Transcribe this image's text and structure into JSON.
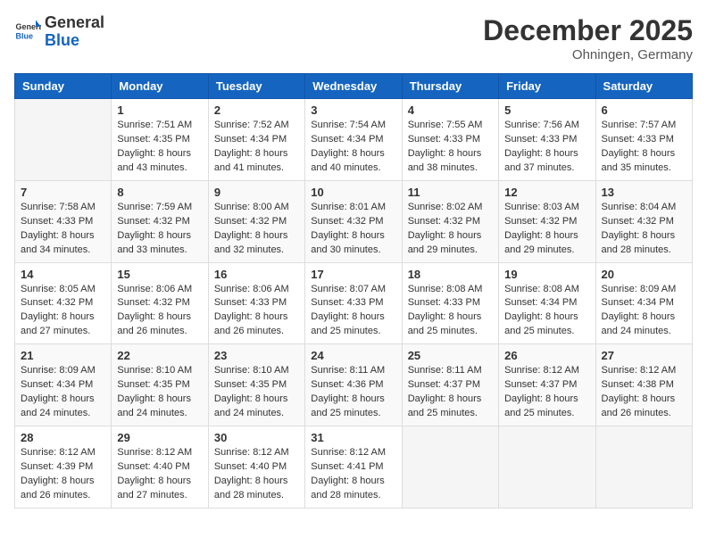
{
  "header": {
    "logo_general": "General",
    "logo_blue": "Blue",
    "month_title": "December 2025",
    "location": "Ohningen, Germany"
  },
  "days_of_week": [
    "Sunday",
    "Monday",
    "Tuesday",
    "Wednesday",
    "Thursday",
    "Friday",
    "Saturday"
  ],
  "weeks": [
    [
      {
        "day": "",
        "sunrise": "",
        "sunset": "",
        "daylight": ""
      },
      {
        "day": "1",
        "sunrise": "7:51 AM",
        "sunset": "4:35 PM",
        "daylight": "8 hours and 43 minutes."
      },
      {
        "day": "2",
        "sunrise": "7:52 AM",
        "sunset": "4:34 PM",
        "daylight": "8 hours and 41 minutes."
      },
      {
        "day": "3",
        "sunrise": "7:54 AM",
        "sunset": "4:34 PM",
        "daylight": "8 hours and 40 minutes."
      },
      {
        "day": "4",
        "sunrise": "7:55 AM",
        "sunset": "4:33 PM",
        "daylight": "8 hours and 38 minutes."
      },
      {
        "day": "5",
        "sunrise": "7:56 AM",
        "sunset": "4:33 PM",
        "daylight": "8 hours and 37 minutes."
      },
      {
        "day": "6",
        "sunrise": "7:57 AM",
        "sunset": "4:33 PM",
        "daylight": "8 hours and 35 minutes."
      }
    ],
    [
      {
        "day": "7",
        "sunrise": "7:58 AM",
        "sunset": "4:33 PM",
        "daylight": "8 hours and 34 minutes."
      },
      {
        "day": "8",
        "sunrise": "7:59 AM",
        "sunset": "4:32 PM",
        "daylight": "8 hours and 33 minutes."
      },
      {
        "day": "9",
        "sunrise": "8:00 AM",
        "sunset": "4:32 PM",
        "daylight": "8 hours and 32 minutes."
      },
      {
        "day": "10",
        "sunrise": "8:01 AM",
        "sunset": "4:32 PM",
        "daylight": "8 hours and 30 minutes."
      },
      {
        "day": "11",
        "sunrise": "8:02 AM",
        "sunset": "4:32 PM",
        "daylight": "8 hours and 29 minutes."
      },
      {
        "day": "12",
        "sunrise": "8:03 AM",
        "sunset": "4:32 PM",
        "daylight": "8 hours and 29 minutes."
      },
      {
        "day": "13",
        "sunrise": "8:04 AM",
        "sunset": "4:32 PM",
        "daylight": "8 hours and 28 minutes."
      }
    ],
    [
      {
        "day": "14",
        "sunrise": "8:05 AM",
        "sunset": "4:32 PM",
        "daylight": "8 hours and 27 minutes."
      },
      {
        "day": "15",
        "sunrise": "8:06 AM",
        "sunset": "4:32 PM",
        "daylight": "8 hours and 26 minutes."
      },
      {
        "day": "16",
        "sunrise": "8:06 AM",
        "sunset": "4:33 PM",
        "daylight": "8 hours and 26 minutes."
      },
      {
        "day": "17",
        "sunrise": "8:07 AM",
        "sunset": "4:33 PM",
        "daylight": "8 hours and 25 minutes."
      },
      {
        "day": "18",
        "sunrise": "8:08 AM",
        "sunset": "4:33 PM",
        "daylight": "8 hours and 25 minutes."
      },
      {
        "day": "19",
        "sunrise": "8:08 AM",
        "sunset": "4:34 PM",
        "daylight": "8 hours and 25 minutes."
      },
      {
        "day": "20",
        "sunrise": "8:09 AM",
        "sunset": "4:34 PM",
        "daylight": "8 hours and 24 minutes."
      }
    ],
    [
      {
        "day": "21",
        "sunrise": "8:09 AM",
        "sunset": "4:34 PM",
        "daylight": "8 hours and 24 minutes."
      },
      {
        "day": "22",
        "sunrise": "8:10 AM",
        "sunset": "4:35 PM",
        "daylight": "8 hours and 24 minutes."
      },
      {
        "day": "23",
        "sunrise": "8:10 AM",
        "sunset": "4:35 PM",
        "daylight": "8 hours and 24 minutes."
      },
      {
        "day": "24",
        "sunrise": "8:11 AM",
        "sunset": "4:36 PM",
        "daylight": "8 hours and 25 minutes."
      },
      {
        "day": "25",
        "sunrise": "8:11 AM",
        "sunset": "4:37 PM",
        "daylight": "8 hours and 25 minutes."
      },
      {
        "day": "26",
        "sunrise": "8:12 AM",
        "sunset": "4:37 PM",
        "daylight": "8 hours and 25 minutes."
      },
      {
        "day": "27",
        "sunrise": "8:12 AM",
        "sunset": "4:38 PM",
        "daylight": "8 hours and 26 minutes."
      }
    ],
    [
      {
        "day": "28",
        "sunrise": "8:12 AM",
        "sunset": "4:39 PM",
        "daylight": "8 hours and 26 minutes."
      },
      {
        "day": "29",
        "sunrise": "8:12 AM",
        "sunset": "4:40 PM",
        "daylight": "8 hours and 27 minutes."
      },
      {
        "day": "30",
        "sunrise": "8:12 AM",
        "sunset": "4:40 PM",
        "daylight": "8 hours and 28 minutes."
      },
      {
        "day": "31",
        "sunrise": "8:12 AM",
        "sunset": "4:41 PM",
        "daylight": "8 hours and 28 minutes."
      },
      {
        "day": "",
        "sunrise": "",
        "sunset": "",
        "daylight": ""
      },
      {
        "day": "",
        "sunrise": "",
        "sunset": "",
        "daylight": ""
      },
      {
        "day": "",
        "sunrise": "",
        "sunset": "",
        "daylight": ""
      }
    ]
  ],
  "labels": {
    "sunrise_prefix": "Sunrise: ",
    "sunset_prefix": "Sunset: ",
    "daylight_prefix": "Daylight: "
  }
}
